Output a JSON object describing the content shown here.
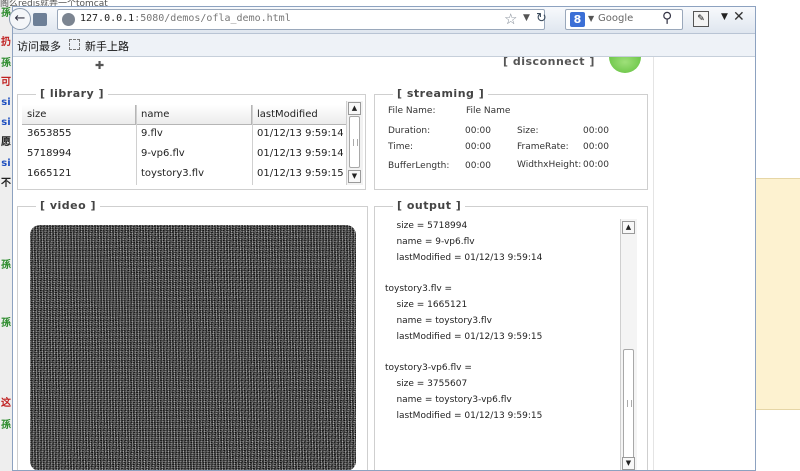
{
  "background": {
    "top_text": "阁么redis就弄一个tomcat",
    "left_glyphs": [
      {
        "char": "孫",
        "color": "#2a8a2a"
      },
      {
        "char": "扔",
        "color": "#c02020"
      },
      {
        "char": "孫",
        "color": "#2a8a2a"
      },
      {
        "char": "可",
        "color": "#c02020"
      },
      {
        "char": "si",
        "color": "#2050c0"
      },
      {
        "char": "si",
        "color": "#2050c0"
      },
      {
        "char": "愿",
        "color": "#222222"
      },
      {
        "char": "si",
        "color": "#2050c0"
      },
      {
        "char": "不",
        "color": "#222222"
      },
      {
        "char": "孫",
        "color": "#2a8a2a"
      },
      {
        "char": "孫",
        "color": "#2a8a2a"
      },
      {
        "char": "这",
        "color": "#c02020"
      },
      {
        "char": "孫",
        "color": "#2a8a2a"
      }
    ]
  },
  "browser": {
    "url_host": "127.0.0.1",
    "url_rest": ":5080/demos/ofla_demo.html",
    "search_placeholder": "Google",
    "search_engine_letter": "8",
    "bookmarks": [
      "访问最多",
      "新手上路"
    ]
  },
  "page": {
    "disconnect_label": "[ disconnect ]",
    "library": {
      "title": "[ library ]",
      "columns": [
        "size",
        "name",
        "lastModified"
      ],
      "rows": [
        {
          "size": "3653855",
          "name": "9.flv",
          "lastModified": "01/12/13 9:59:14"
        },
        {
          "size": "5718994",
          "name": "9-vp6.flv",
          "lastModified": "01/12/13 9:59:14"
        },
        {
          "size": "1665121",
          "name": "toystory3.flv",
          "lastModified": "01/12/13 9:59:15"
        }
      ]
    },
    "streaming": {
      "title": "[ streaming ]",
      "file_name_label": "File Name:",
      "file_name_value": "File Name",
      "duration_label": "Duration:",
      "duration_value": "00:00",
      "size_label": "Size:",
      "size_value": "00:00",
      "time_label": "Time:",
      "time_value": "00:00",
      "framerate_label": "FrameRate:",
      "framerate_value": "00:00",
      "bufferlength_label": "BufferLength:",
      "bufferlength_value": "00:00",
      "widthheight_label": "WidthxHeight:",
      "widthheight_value": "00:00"
    },
    "video": {
      "title": "[ video ]"
    },
    "output": {
      "title": "[ output ]",
      "lines": [
        "    size = 5718994",
        "    name = 9-vp6.flv",
        "    lastModified = 01/12/13 9:59:14",
        "",
        "toystory3.flv =",
        "    size = 1665121",
        "    name = toystory3.flv",
        "    lastModified = 01/12/13 9:59:15",
        "",
        "toystory3-vp6.flv =",
        "    size = 3755607",
        "    name = toystory3-vp6.flv",
        "    lastModified = 01/12/13 9:59:15"
      ]
    }
  }
}
